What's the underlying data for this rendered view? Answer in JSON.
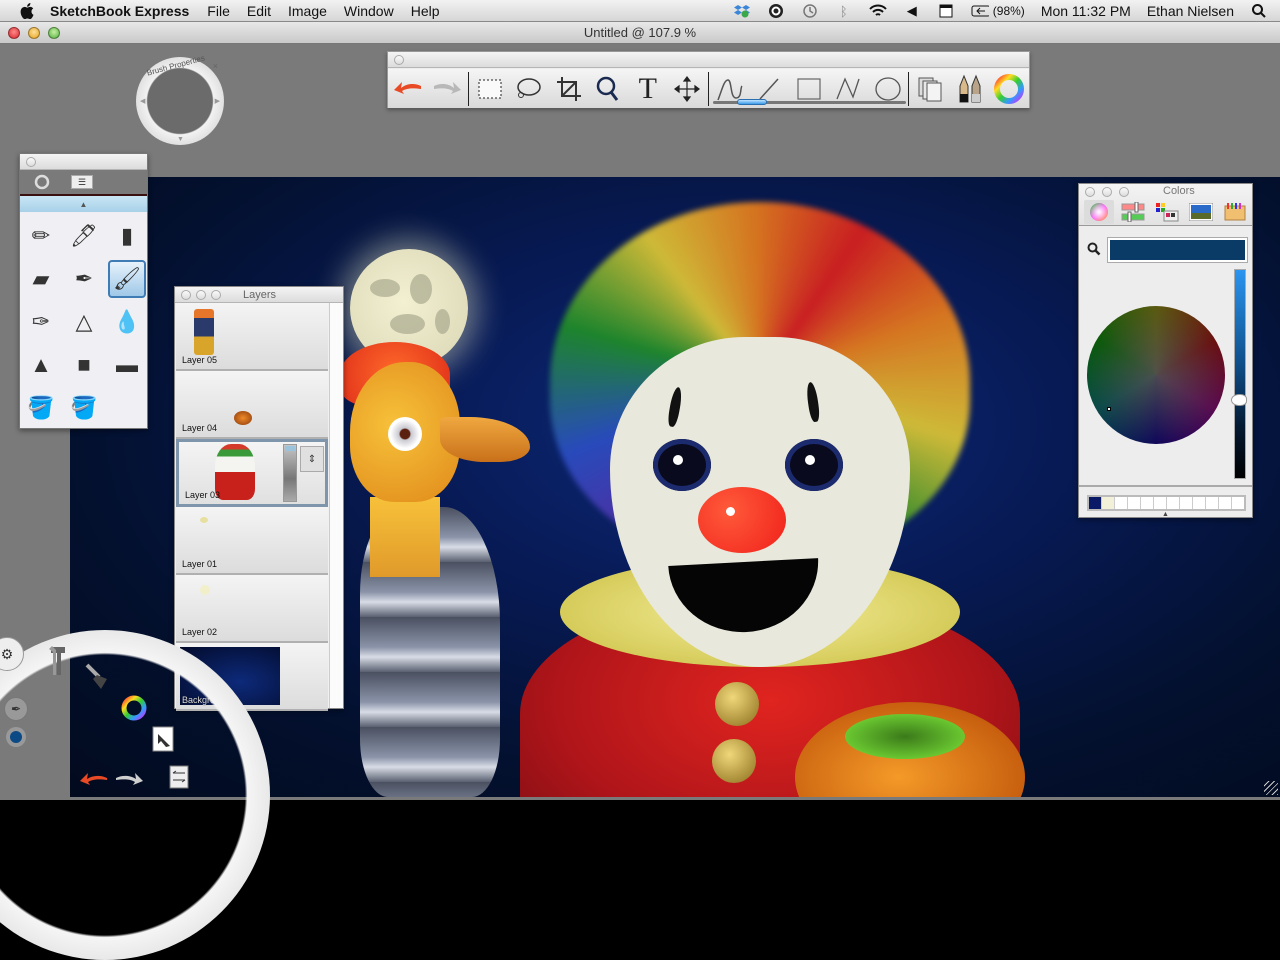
{
  "menubar": {
    "apple_icon": "apple-icon",
    "app_name": "SketchBook Express",
    "menus": [
      "File",
      "Edit",
      "Image",
      "Window",
      "Help"
    ],
    "status_icons": [
      "dropbox-icon",
      "sync-icon",
      "time-machine-icon",
      "bluetooth-icon",
      "wifi-icon",
      "volume-icon",
      "input-menu-icon",
      "battery-icon"
    ],
    "battery": "(98%)",
    "clock": "Mon 11:32 PM",
    "user": "Ethan Nielsen",
    "spotlight_icon": "spotlight-icon"
  },
  "window": {
    "title": "Untitled @ 107.9 %"
  },
  "toolbar": {
    "tools": [
      {
        "name": "undo",
        "glyph": "↩"
      },
      {
        "name": "redo",
        "glyph": "↪"
      },
      {
        "name": "rectangle-select",
        "glyph": "⬚"
      },
      {
        "name": "lasso-select",
        "glyph": "◯"
      },
      {
        "name": "crop",
        "glyph": "⌗"
      },
      {
        "name": "zoom",
        "glyph": "🔍"
      },
      {
        "name": "text",
        "glyph": "T"
      },
      {
        "name": "move",
        "glyph": "✥"
      },
      {
        "name": "freehand-stroke",
        "glyph": "∿"
      },
      {
        "name": "line",
        "glyph": "╱"
      },
      {
        "name": "rectangle",
        "glyph": "□"
      },
      {
        "name": "polyline",
        "glyph": "⋀"
      },
      {
        "name": "ellipse",
        "glyph": "○"
      },
      {
        "name": "layers",
        "glyph": "❐"
      },
      {
        "name": "brushes",
        "glyph": "✎"
      },
      {
        "name": "color-wheel",
        "glyph": "◎"
      }
    ],
    "brush_size_fraction": 0.15
  },
  "brush_properties": {
    "label": "Brush Properties",
    "close": "×"
  },
  "brush_palette": {
    "tabs": [
      "brush-puck",
      "brush-settings"
    ],
    "brushes": [
      {
        "name": "pencil",
        "glyph": "✏"
      },
      {
        "name": "ballpoint-pen",
        "glyph": "🖊"
      },
      {
        "name": "marker",
        "glyph": "▮"
      },
      {
        "name": "chisel-marker",
        "glyph": "▰"
      },
      {
        "name": "felt-pen",
        "glyph": "✒"
      },
      {
        "name": "paintbrush",
        "glyph": "🖌",
        "selected": true
      },
      {
        "name": "ink-brush",
        "glyph": "✑"
      },
      {
        "name": "airbrush",
        "glyph": "△"
      },
      {
        "name": "smudge",
        "glyph": "💧"
      },
      {
        "name": "hard-airbrush",
        "glyph": "▲"
      },
      {
        "name": "hard-eraser",
        "glyph": "■"
      },
      {
        "name": "soft-eraser",
        "glyph": "▬"
      },
      {
        "name": "fill-bucket",
        "glyph": "🪣"
      },
      {
        "name": "fill-bucket-layer",
        "glyph": "🪣"
      }
    ]
  },
  "layers": {
    "title": "Layers",
    "items": [
      {
        "name": "Layer 05",
        "selected": false
      },
      {
        "name": "Layer 04",
        "selected": false
      },
      {
        "name": "Layer 03",
        "selected": true
      },
      {
        "name": "Layer 01",
        "selected": false
      },
      {
        "name": "Layer 02",
        "selected": false
      },
      {
        "name": "Background",
        "selected": false
      }
    ]
  },
  "colors": {
    "title": "Colors",
    "modes": [
      "color-wheel-mode",
      "color-sliders-mode",
      "color-palettes-mode",
      "image-palettes-mode",
      "crayons-mode"
    ],
    "current_color": "#0a3a66",
    "brightness_fraction": 0.35,
    "swatches": [
      "#0a1a66",
      "#f2f0d8",
      "",
      "",
      "",
      "",
      "",
      "",
      "",
      "",
      "",
      ""
    ]
  },
  "lagoon": {
    "items": [
      "lagoon-menu",
      "tools",
      "brush-editor",
      "color-editor",
      "select",
      "layers"
    ],
    "undo": "↩",
    "redo": "↪",
    "current_brush": "paintbrush",
    "current_color": "#0c4a86"
  }
}
